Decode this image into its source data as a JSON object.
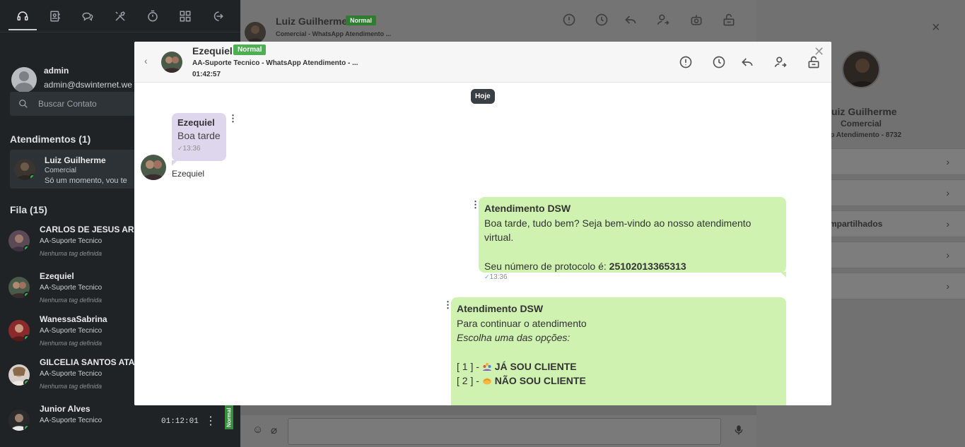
{
  "sidebar": {
    "user": {
      "name": "admin",
      "email": "admin@dswinternet.we"
    },
    "search_placeholder": "Buscar Contato",
    "atendimentos_title": "Atendimentos (1)",
    "active": {
      "name": "Luiz Guilherme",
      "dept": "Comercial",
      "msg": "Só um momento, vou te"
    },
    "fila_title": "Fila (15)",
    "queue": [
      {
        "name": "CARLOS DE JESUS AR",
        "dept": "AA-Suporte Tecnico",
        "tag": "Nenhuma tag definida"
      },
      {
        "name": "Ezequiel",
        "dept": "AA-Suporte Tecnico",
        "tag": "Nenhuma tag definida"
      },
      {
        "name": "WanessaSabrina",
        "dept": "AA-Suporte Tecnico",
        "tag": "Nenhuma tag definida"
      },
      {
        "name": "GILCELIA SANTOS ATA",
        "dept": "AA-Suporte Tecnico",
        "tag": "Nenhuma tag definida"
      },
      {
        "name": "Junior Alves",
        "dept": "AA-Suporte Tecnico",
        "time": "01:12:01",
        "badge": "Normal"
      }
    ]
  },
  "bg_chat": {
    "name": "Luiz Guilherme",
    "badge": "Normal",
    "subtitle": "Comercial - WhatsApp Atendimento ..."
  },
  "right_panel": {
    "name": "Luiz Guilherme",
    "dept": "Comercial",
    "subtitle": "App Atendimento - 8732",
    "rows": [
      "",
      "",
      "mpartilhados",
      "",
      ""
    ]
  },
  "modal": {
    "name": "Ezequiel",
    "badge": "Normal",
    "subtitle": "AA-Suporte Tecnico - WhatsApp Atendimento - ...",
    "elapsed": "01:42:57",
    "day_label": "Hoje",
    "incoming": {
      "sender": "Ezequiel",
      "text": "Boa tarde",
      "time": "13:36",
      "author": "Ezequiel"
    },
    "out1": {
      "sender": "Atendimento DSW",
      "line1": "Boa tarde, tudo bem? Seja bem-vindo ao nosso atendimento virtual.",
      "line2": "Seu número de protocolo é: ",
      "protocol": "25102013365313",
      "time": "13:36"
    },
    "out2": {
      "sender": "Atendimento DSW",
      "line1": "Para continuar o atendimento",
      "line2": "Escolha uma das opções:",
      "opt1_prefix": "[ 1 ] - ",
      "opt1_label": "JÁ SOU CLIENTE",
      "opt2_prefix": "[ 2 ] - ",
      "opt2_label": "NÃO SOU CLIENTE"
    }
  },
  "colors": {
    "sidebar_bg": "#202326",
    "incoming_bubble": "#ddd6ec",
    "outgoing_bubble": "#cff2b1",
    "badge_green": "#4caf50",
    "online_dot": "#39b54a"
  },
  "icons": {
    "topnav": [
      "headset-icon",
      "contacts-icon",
      "chats-icon",
      "tools-icon",
      "timer-icon",
      "dashboard-icon",
      "logout-icon"
    ],
    "header_actions": [
      "alert-icon",
      "clock-icon",
      "reply-icon",
      "transfer-user-icon",
      "lock-open-icon"
    ]
  }
}
